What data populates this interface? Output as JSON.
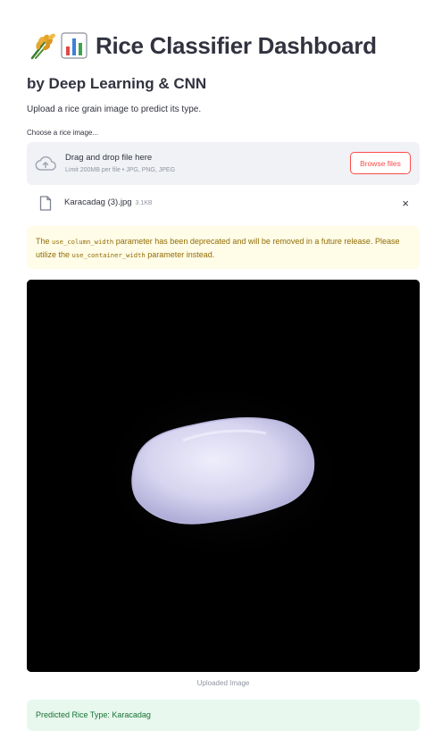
{
  "header": {
    "title": "Rice Classifier Dashboard",
    "subtitle": "by Deep Learning & CNN",
    "description": "Upload a rice grain image to predict its type.",
    "icons": [
      "rice-sheaf-icon",
      "bar-chart-icon"
    ]
  },
  "uploader": {
    "label": "Choose a rice image...",
    "drop_text": "Drag and drop file here",
    "limit_text": "Limit 200MB per file • JPG, PNG, JPEG",
    "browse_label": "Browse files",
    "icon": "cloud-upload-icon"
  },
  "uploaded_file": {
    "name": "Karacadag (3).jpg",
    "size": "3.1KB",
    "icon": "file-icon",
    "remove_label": "×"
  },
  "warning": {
    "pre": "The ",
    "code1": "use_column_width",
    "mid": " parameter has been deprecated and will be removed in a future release. Please utilize the ",
    "code2": "use_container_width",
    "post": " parameter instead."
  },
  "image": {
    "caption": "Uploaded Image"
  },
  "result": {
    "text": "Predicted Rice Type: Karacadag"
  },
  "colors": {
    "primary": "#ff4b4b",
    "warning_bg": "#fffce7",
    "warning_text": "#926c05",
    "success_bg": "#e8f8ee",
    "success_text": "#177233",
    "dropzone_bg": "#f0f2f6"
  }
}
